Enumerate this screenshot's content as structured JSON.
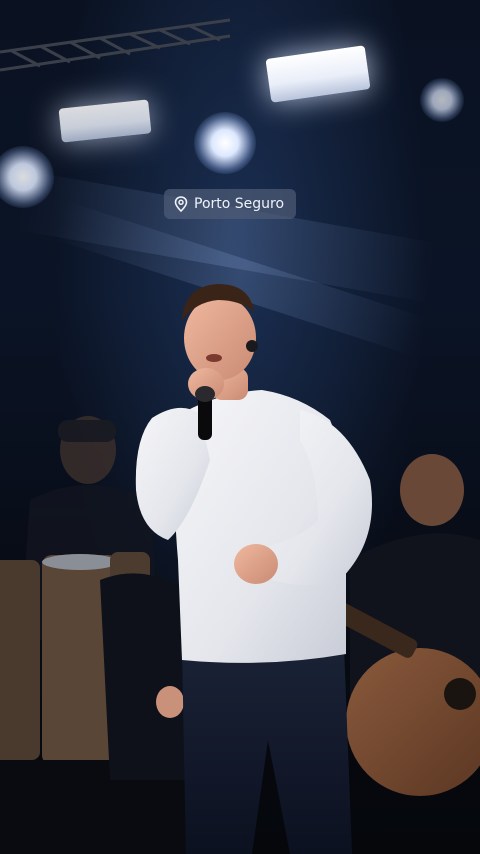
{
  "location": {
    "label": "Porto Seguro",
    "icon": "map-pin-icon"
  },
  "colors": {
    "badge_background": "#4e5c76",
    "badge_text": "#eef2fa",
    "stage_background": "#0a1222"
  }
}
